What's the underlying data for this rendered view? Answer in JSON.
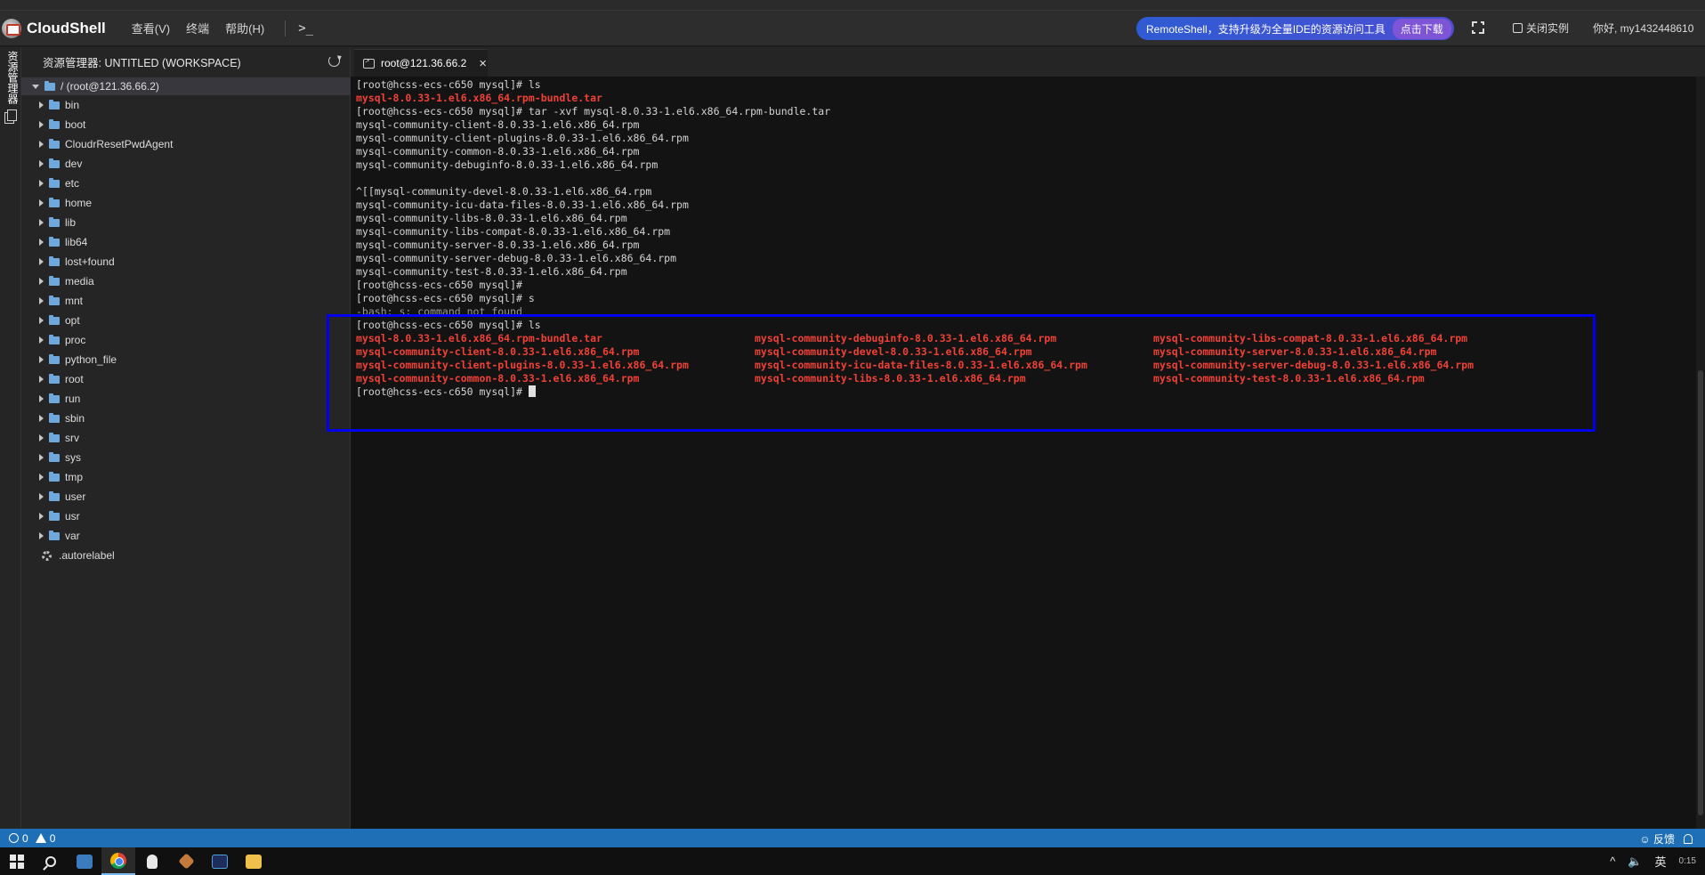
{
  "app": {
    "name": "CloudShell",
    "menu": [
      "查看(V)",
      "终端",
      "帮助(H)"
    ],
    "terminal_icon": ">_",
    "promo_text": "RemoteShell，支持升级为全量IDE的资源访问工具",
    "promo_button": "点击下载",
    "close_instance": "关闭实例",
    "greeting": "你好, my1432448610"
  },
  "activity_bar": {
    "explorer_label": "资源管理器"
  },
  "explorer": {
    "title": "资源管理器: UNTITLED (WORKSPACE)",
    "root": "/ (root@121.36.66.2)",
    "folders": [
      "bin",
      "boot",
      "CloudrResetPwdAgent",
      "dev",
      "etc",
      "home",
      "lib",
      "lib64",
      "lost+found",
      "media",
      "mnt",
      "opt",
      "proc",
      "python_file",
      "root",
      "run",
      "sbin",
      "srv",
      "sys",
      "tmp",
      "user",
      "usr",
      "var"
    ],
    "files": [
      ".autorelabel"
    ]
  },
  "tab": {
    "label": "root@121.36.66.2",
    "close": "×"
  },
  "terminal": {
    "prompt": "[root@hcss-ecs-c650 mysql]#",
    "lines_before": [
      {
        "text": "[root@hcss-ecs-c650 mysql]# ls",
        "style": "normal"
      },
      {
        "text": "mysql-8.0.33-1.el6.x86_64.rpm-bundle.tar",
        "style": "red"
      },
      {
        "text": "[root@hcss-ecs-c650 mysql]# tar -xvf mysql-8.0.33-1.el6.x86_64.rpm-bundle.tar",
        "style": "normal"
      },
      {
        "text": "mysql-community-client-8.0.33-1.el6.x86_64.rpm",
        "style": "normal"
      },
      {
        "text": "mysql-community-client-plugins-8.0.33-1.el6.x86_64.rpm",
        "style": "normal"
      },
      {
        "text": "mysql-community-common-8.0.33-1.el6.x86_64.rpm",
        "style": "normal"
      },
      {
        "text": "mysql-community-debuginfo-8.0.33-1.el6.x86_64.rpm",
        "style": "normal"
      },
      {
        "text": "",
        "style": "normal"
      },
      {
        "text": "^[[mysql-community-devel-8.0.33-1.el6.x86_64.rpm",
        "style": "normal"
      },
      {
        "text": "mysql-community-icu-data-files-8.0.33-1.el6.x86_64.rpm",
        "style": "normal"
      },
      {
        "text": "mysql-community-libs-8.0.33-1.el6.x86_64.rpm",
        "style": "normal"
      },
      {
        "text": "mysql-community-libs-compat-8.0.33-1.el6.x86_64.rpm",
        "style": "normal"
      },
      {
        "text": "mysql-community-server-8.0.33-1.el6.x86_64.rpm",
        "style": "normal"
      },
      {
        "text": "mysql-community-server-debug-8.0.33-1.el6.x86_64.rpm",
        "style": "normal"
      },
      {
        "text": "mysql-community-test-8.0.33-1.el6.x86_64.rpm",
        "style": "normal"
      },
      {
        "text": "[root@hcss-ecs-c650 mysql]#",
        "style": "normal"
      },
      {
        "text": "[root@hcss-ecs-c650 mysql]# s",
        "style": "normal"
      },
      {
        "text": "-bash: s: command not found",
        "style": "dim"
      },
      {
        "text": "[root@hcss-ecs-c650 mysql]# ls",
        "style": "normal"
      }
    ],
    "ls_output": [
      "mysql-8.0.33-1.el6.x86_64.rpm-bundle.tar",
      "mysql-community-debuginfo-8.0.33-1.el6.x86_64.rpm",
      "mysql-community-libs-compat-8.0.33-1.el6.x86_64.rpm",
      "mysql-community-client-8.0.33-1.el6.x86_64.rpm",
      "mysql-community-devel-8.0.33-1.el6.x86_64.rpm",
      "mysql-community-server-8.0.33-1.el6.x86_64.rpm",
      "mysql-community-client-plugins-8.0.33-1.el6.x86_64.rpm",
      "mysql-community-icu-data-files-8.0.33-1.el6.x86_64.rpm",
      "mysql-community-server-debug-8.0.33-1.el6.x86_64.rpm",
      "mysql-community-common-8.0.33-1.el6.x86_64.rpm",
      "mysql-community-libs-8.0.33-1.el6.x86_64.rpm",
      "mysql-community-test-8.0.33-1.el6.x86_64.rpm"
    ],
    "final_prompt": "[root@hcss-ecs-c650 mysql]# "
  },
  "statusbar": {
    "errors": "0",
    "warnings": "0",
    "feedback": "反馈"
  },
  "taskbar": {
    "ime": "英",
    "clock": "0:15"
  },
  "colors": {
    "accent_blue": "#1f6fb6",
    "terminal_red": "#ef4136",
    "highlight_box": "#0000ee"
  }
}
